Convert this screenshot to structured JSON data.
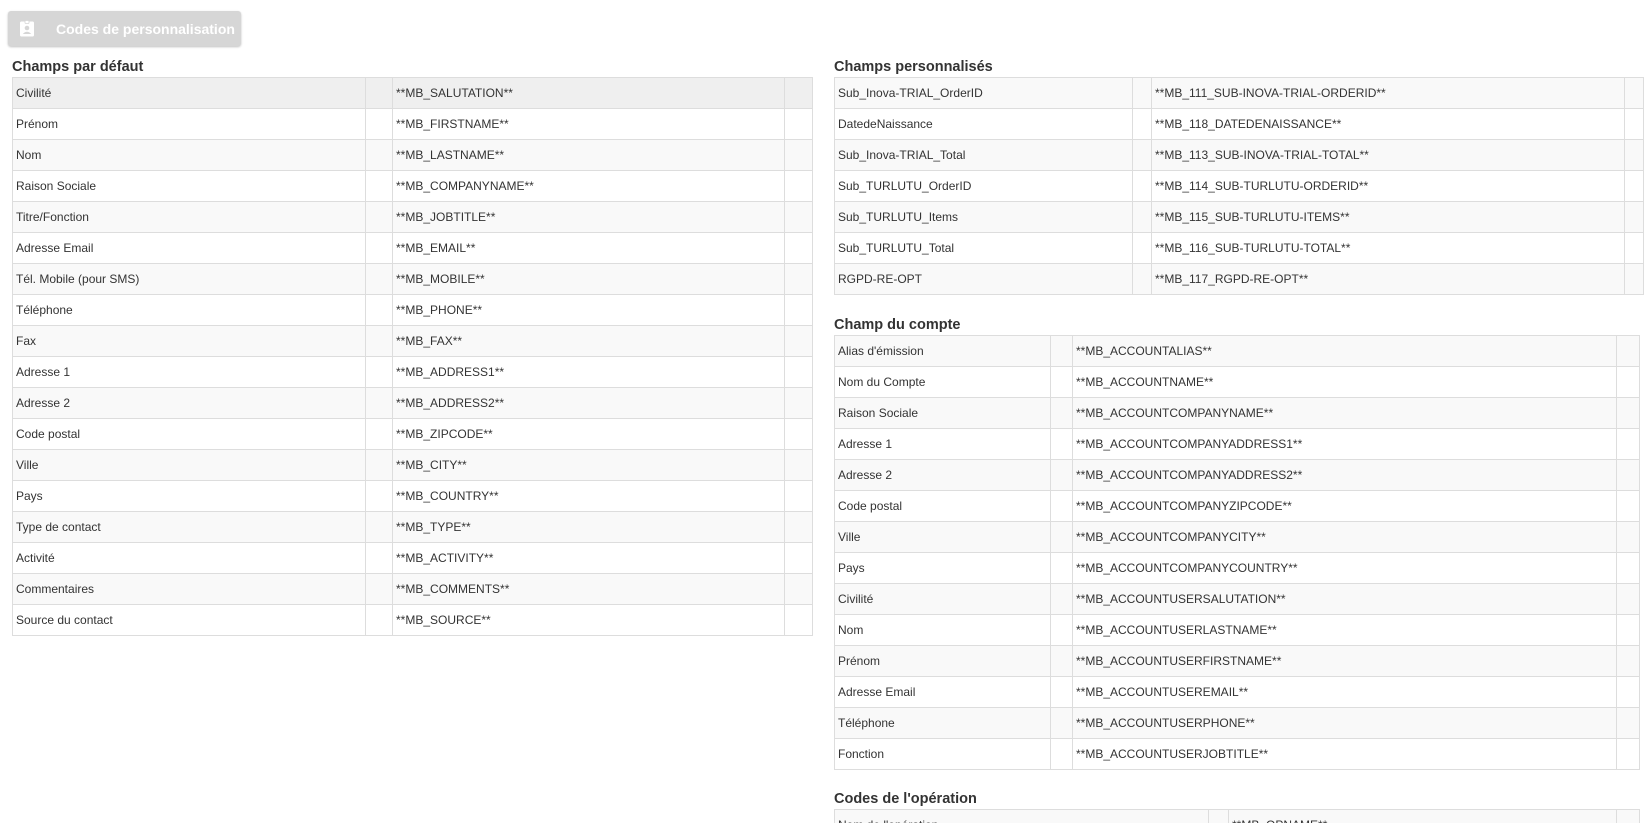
{
  "header": {
    "button_label": "Codes de personnalisation",
    "icon": "id-badge-icon"
  },
  "default_fields": {
    "title": "Champs par défaut",
    "rows": [
      {
        "label": "Civilité",
        "code": "**MB_SALUTATION**"
      },
      {
        "label": "Prénom",
        "code": "**MB_FIRSTNAME**"
      },
      {
        "label": "Nom",
        "code": "**MB_LASTNAME**"
      },
      {
        "label": "Raison Sociale",
        "code": "**MB_COMPANYNAME**"
      },
      {
        "label": "Titre/Fonction",
        "code": "**MB_JOBTITLE**"
      },
      {
        "label": "Adresse Email",
        "code": "**MB_EMAIL**"
      },
      {
        "label": "Tél. Mobile (pour SMS)",
        "code": "**MB_MOBILE**"
      },
      {
        "label": "Téléphone",
        "code": "**MB_PHONE**"
      },
      {
        "label": "Fax",
        "code": "**MB_FAX**"
      },
      {
        "label": "Adresse 1",
        "code": "**MB_ADDRESS1**"
      },
      {
        "label": "Adresse 2",
        "code": "**MB_ADDRESS2**"
      },
      {
        "label": "Code postal",
        "code": "**MB_ZIPCODE**"
      },
      {
        "label": "Ville",
        "code": "**MB_CITY**"
      },
      {
        "label": "Pays",
        "code": "**MB_COUNTRY**"
      },
      {
        "label": "Type de contact",
        "code": "**MB_TYPE**"
      },
      {
        "label": "Activité",
        "code": "**MB_ACTIVITY**"
      },
      {
        "label": "Commentaires",
        "code": "**MB_COMMENTS**"
      },
      {
        "label": "Source du contact",
        "code": "**MB_SOURCE**"
      }
    ]
  },
  "custom_fields": {
    "title": "Champs personnalisés",
    "rows": [
      {
        "label": "Sub_Inova-TRIAL_OrderID",
        "code": "**MB_111_SUB-INOVA-TRIAL-ORDERID**"
      },
      {
        "label": "DatedeNaissance",
        "code": "**MB_118_DATEDENAISSANCE**"
      },
      {
        "label": "Sub_Inova-TRIAL_Total",
        "code": "**MB_113_SUB-INOVA-TRIAL-TOTAL**"
      },
      {
        "label": "Sub_TURLUTU_OrderID",
        "code": "**MB_114_SUB-TURLUTU-ORDERID**"
      },
      {
        "label": "Sub_TURLUTU_Items",
        "code": "**MB_115_SUB-TURLUTU-ITEMS**"
      },
      {
        "label": "Sub_TURLUTU_Total",
        "code": "**MB_116_SUB-TURLUTU-TOTAL**"
      },
      {
        "label": "RGPD-RE-OPT",
        "code": "**MB_117_RGPD-RE-OPT**"
      }
    ]
  },
  "account_fields": {
    "title": "Champ du compte",
    "rows": [
      {
        "label": "Alias d'émission",
        "code": "**MB_ACCOUNTALIAS**"
      },
      {
        "label": "Nom du Compte",
        "code": "**MB_ACCOUNTNAME**"
      },
      {
        "label": "Raison Sociale",
        "code": "**MB_ACCOUNTCOMPANYNAME**"
      },
      {
        "label": "Adresse 1",
        "code": "**MB_ACCOUNTCOMPANYADDRESS1**"
      },
      {
        "label": "Adresse 2",
        "code": "**MB_ACCOUNTCOMPANYADDRESS2**"
      },
      {
        "label": "Code postal",
        "code": "**MB_ACCOUNTCOMPANYZIPCODE**"
      },
      {
        "label": "Ville",
        "code": "**MB_ACCOUNTCOMPANYCITY**"
      },
      {
        "label": "Pays",
        "code": "**MB_ACCOUNTCOMPANYCOUNTRY**"
      },
      {
        "label": "Civilité",
        "code": "**MB_ACCOUNTUSERSALUTATION**"
      },
      {
        "label": "Nom",
        "code": "**MB_ACCOUNTUSERLASTNAME**"
      },
      {
        "label": "Prénom",
        "code": "**MB_ACCOUNTUSERFIRSTNAME**"
      },
      {
        "label": "Adresse Email",
        "code": "**MB_ACCOUNTUSEREMAIL**"
      },
      {
        "label": "Téléphone",
        "code": "**MB_ACCOUNTUSERPHONE**"
      },
      {
        "label": "Fonction",
        "code": "**MB_ACCOUNTUSERJOBTITLE**"
      }
    ]
  },
  "operation_fields": {
    "title": "Codes de l'opération",
    "rows": [
      {
        "label": "Nom de l'opération",
        "code": "**MB_OPNAME**"
      }
    ]
  }
}
